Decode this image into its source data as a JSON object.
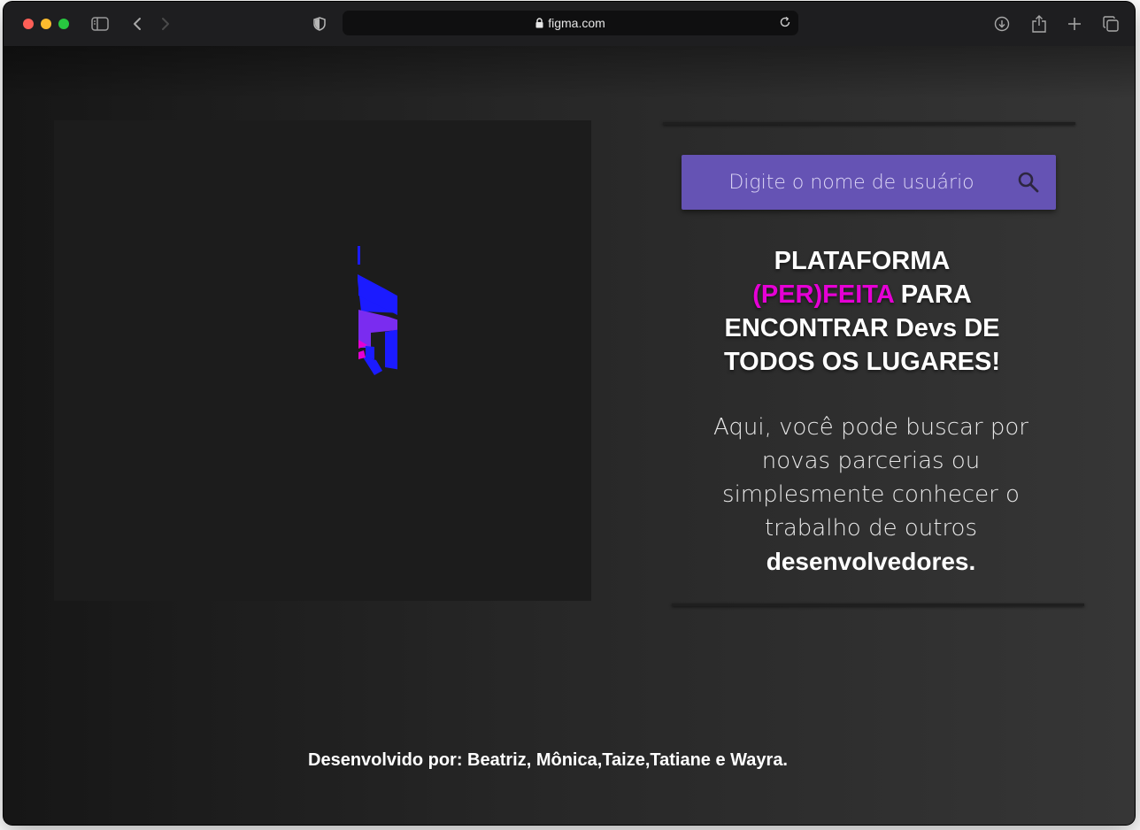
{
  "browser": {
    "url": "figma.com"
  },
  "search": {
    "placeholder": "Digite o nome de usuário"
  },
  "headline": {
    "line1": "PLATAFORMA",
    "accent": "(PER)FEITA",
    "line2_rest": " PARA",
    "line3": "ENCONTRAR Devs DE",
    "line4": "TODOS OS LUGARES!"
  },
  "description": {
    "text": "Aqui, você pode buscar por novas parcerias ou simplesmente conhecer o trabalho de outros",
    "emphasis": "desenvolvedores."
  },
  "footer": {
    "credits": "Desenvolvido por: Beatriz, Mônica,Taize,Tatiane e Wayra."
  },
  "colors": {
    "search_background": "#6553b4",
    "accent_pink": "#e500d5",
    "logo_blue": "#1b1bff",
    "logo_purple": "#7a2cf0"
  },
  "icons": [
    "sidebar-icon",
    "back-icon",
    "forward-icon",
    "shield-icon",
    "lock-icon",
    "reload-icon",
    "download-icon",
    "share-icon",
    "new-tab-icon",
    "tabs-overview-icon",
    "search-icon"
  ]
}
